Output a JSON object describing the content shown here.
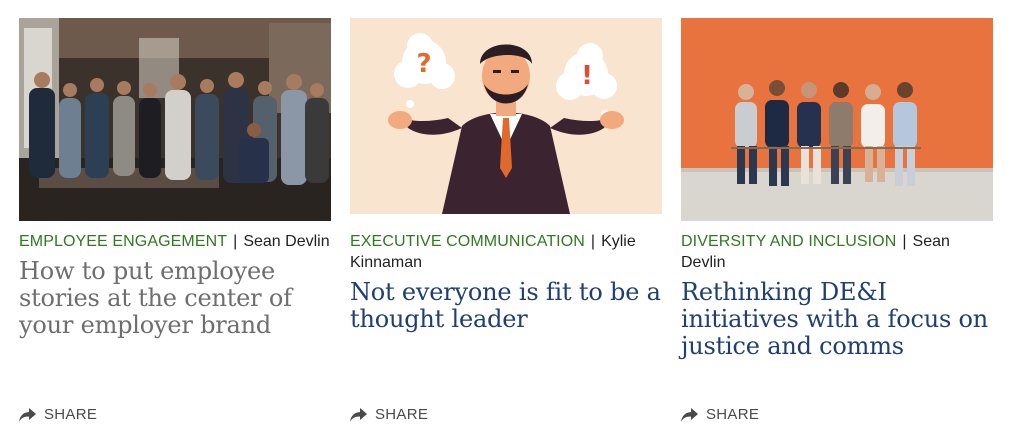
{
  "cards": [
    {
      "category": "EMPLOYEE ENGAGEMENT",
      "separator": "|",
      "author": "Sean Devlin",
      "title": "How to put employee stories at the center of your employer brand",
      "share_label": "SHARE",
      "image_icon": "team-photo",
      "title_color": "#6e6e6e"
    },
    {
      "category": "EXECUTIVE COMMUNICATION",
      "separator": "|",
      "author": "Kylie Kinnaman",
      "title": "Not everyone is fit to be a thought leader",
      "share_label": "SHARE",
      "image_icon": "confused-businessman-illustration",
      "title_color": "#1f3f73"
    },
    {
      "category": "DIVERSITY AND INCLUSION",
      "separator": "|",
      "author": "Sean Devlin",
      "title": "Rethinking DE&I initiatives with a focus on justice and comms",
      "share_label": "SHARE",
      "image_icon": "seated-people-photo",
      "title_color": "#1f3f73"
    }
  ],
  "colors": {
    "category": "#2f7a1f",
    "share": "#4a4a4a",
    "illustration_bg": "#f9e4cf",
    "orange_wall": "#e8733f"
  }
}
